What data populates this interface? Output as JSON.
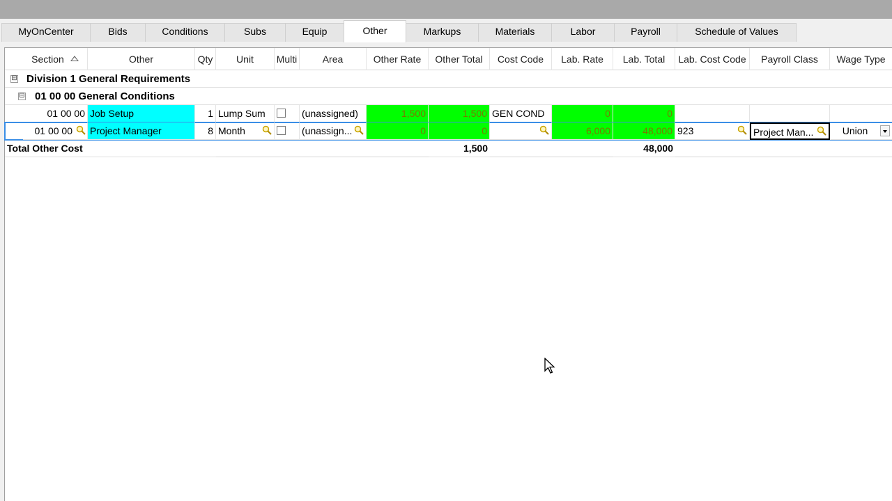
{
  "tabs": [
    {
      "label": "MyOnCenter",
      "active": false
    },
    {
      "label": "Bids",
      "active": false
    },
    {
      "label": "Conditions",
      "active": false
    },
    {
      "label": "Subs",
      "active": false
    },
    {
      "label": "Equip",
      "active": false
    },
    {
      "label": "Other",
      "active": true
    },
    {
      "label": "Markups",
      "active": false
    },
    {
      "label": "Materials",
      "active": false
    },
    {
      "label": "Labor",
      "active": false
    },
    {
      "label": "Payroll",
      "active": false
    },
    {
      "label": "Schedule of Values",
      "active": false
    }
  ],
  "columns": [
    "Section",
    "Other",
    "Qty",
    "Unit",
    "Multi",
    "Area",
    "Other Rate",
    "Other Total",
    "Cost Code",
    "Lab. Rate",
    "Lab. Total",
    "Lab. Cost Code",
    "Payroll Class",
    "Wage Type"
  ],
  "groups": {
    "division": {
      "expander": "⊟",
      "label": "Division 1 General Requirements"
    },
    "subgroup": {
      "expander": "⊟",
      "label": "01 00 00 General Conditions"
    }
  },
  "rows": [
    {
      "section": "01 00 00",
      "other": "Job Setup",
      "qty": "1",
      "unit": "Lump Sum",
      "multi": false,
      "area": "(unassigned)",
      "other_rate": "1,500",
      "other_total": "1,500",
      "cost_code": "GEN COND",
      "lab_rate": "0",
      "lab_total": "0",
      "lab_cost_code": "",
      "payroll_class": "",
      "wage_type": ""
    },
    {
      "section": "01 00 00",
      "other": "Project Manager",
      "qty": "8",
      "unit": "Month",
      "multi": false,
      "area": "(unassign...",
      "other_rate": "0",
      "other_total": "0",
      "cost_code": "",
      "lab_rate": "6,000",
      "lab_total": "48,000",
      "lab_cost_code": "923",
      "payroll_class": "Project Man...",
      "wage_type": "Union"
    }
  ],
  "totals": {
    "label": "Total Other Cost",
    "other_total": "1,500",
    "lab_total": "48,000"
  },
  "colors": {
    "cyan": "#00ffff",
    "green": "#00ff00",
    "selection": "#3a8ee6"
  }
}
